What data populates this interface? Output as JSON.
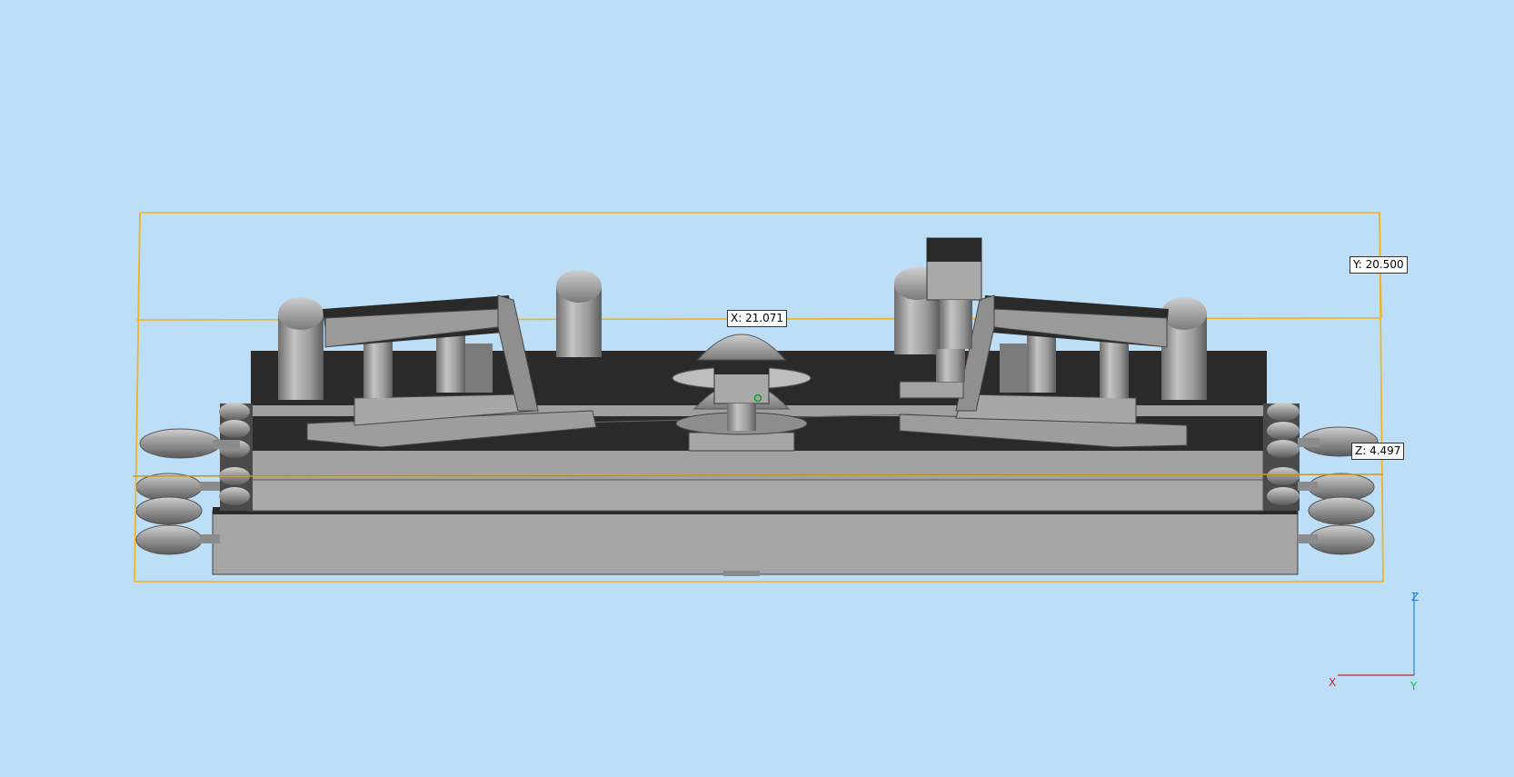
{
  "viewport": {
    "background_color": "#bcdff7",
    "bounding_box_color": "#f0b423",
    "model_dark_color": "#2a2a2a",
    "model_light_color": "#a3a3a3"
  },
  "dimensions": {
    "x_label": "X: 21.071",
    "y_label": "Y: 20.500",
    "z_label": "Z: 4.497"
  },
  "axis_triad": {
    "x": "X",
    "y": "Y",
    "z": "Z",
    "x_color": "#d02020",
    "y_color": "#22b84a",
    "z_color": "#2a7fd4"
  }
}
